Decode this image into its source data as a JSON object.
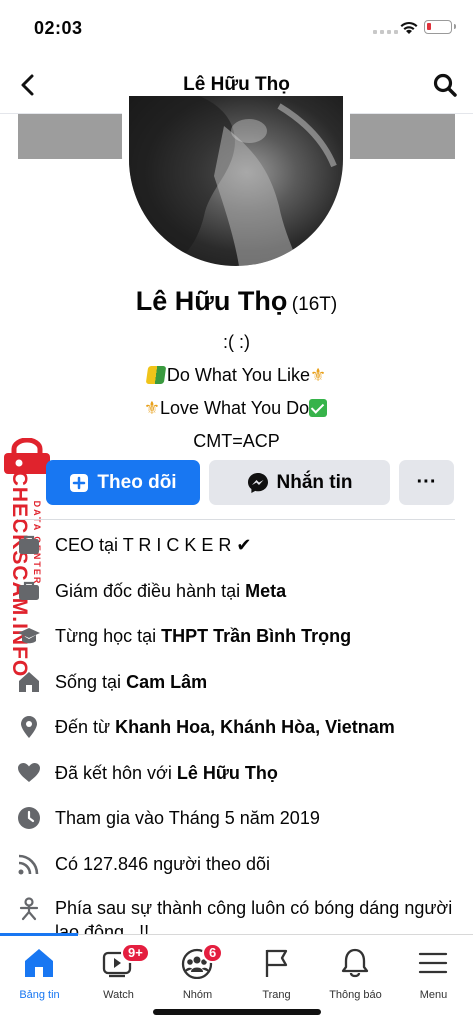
{
  "status_bar": {
    "time": "02:03"
  },
  "header": {
    "title": "Lê Hữu Thọ",
    "back_icon": "chevron-left-icon",
    "search_icon": "search-icon"
  },
  "profile": {
    "name": "Lê Hữu Thọ",
    "tag": "(16T)",
    "bio": [
      ":( :)",
      "Do What You Like",
      "Love What You Do",
      "CMT=ACP"
    ],
    "colors": {
      "cover": "#9d9d9d"
    }
  },
  "actions": {
    "follow": "Theo dõi",
    "message": "Nhắn tin",
    "more": "···",
    "primary_color": "#1877f2",
    "secondary_color": "#e4e6eb"
  },
  "info": [
    {
      "icon": "briefcase-icon",
      "prefix": "CEO tại",
      "value": "T R I C K E R ✔"
    },
    {
      "icon": "briefcase-icon",
      "prefix": "Giám đốc điều hành tại",
      "value": "Meta"
    },
    {
      "icon": "graduation-cap-icon",
      "prefix": "Từng học tại",
      "value": "THPT Trần Bình Trọng"
    },
    {
      "icon": "home-icon",
      "prefix": "Sống tại",
      "value": "Cam Lâm"
    },
    {
      "icon": "location-pin-icon",
      "prefix": "Đến từ",
      "value": "Khanh Hoa, Khánh Hòa, Vietnam"
    },
    {
      "icon": "heart-icon",
      "prefix": "Đã kết hôn với",
      "value": "Lê Hữu Thọ"
    },
    {
      "icon": "clock-icon",
      "prefix": "Tham gia vào Tháng 5 năm 2019",
      "value": ""
    },
    {
      "icon": "rss-icon",
      "prefix": "Có 127.846 người theo dõi",
      "value": ""
    },
    {
      "icon": "person-icon",
      "prefix": "Phía sau sự thành công luôn có bóng dáng người lao động...!!",
      "value": ""
    }
  ],
  "watermark": {
    "site": "CHECKSCAM.INFO",
    "subtitle": "DATA CENTER"
  },
  "tabbar": {
    "tabs": [
      {
        "label": "Bảng tin",
        "icon": "home-icon",
        "active": true
      },
      {
        "label": "Watch",
        "icon": "video-icon",
        "badge": "9+"
      },
      {
        "label": "Nhóm",
        "icon": "groups-icon",
        "badge": "6"
      },
      {
        "label": "Trang",
        "icon": "flag-icon"
      },
      {
        "label": "Thông báo",
        "icon": "bell-icon"
      },
      {
        "label": "Menu",
        "icon": "hamburger-icon"
      }
    ],
    "active_color": "#1877f2"
  }
}
